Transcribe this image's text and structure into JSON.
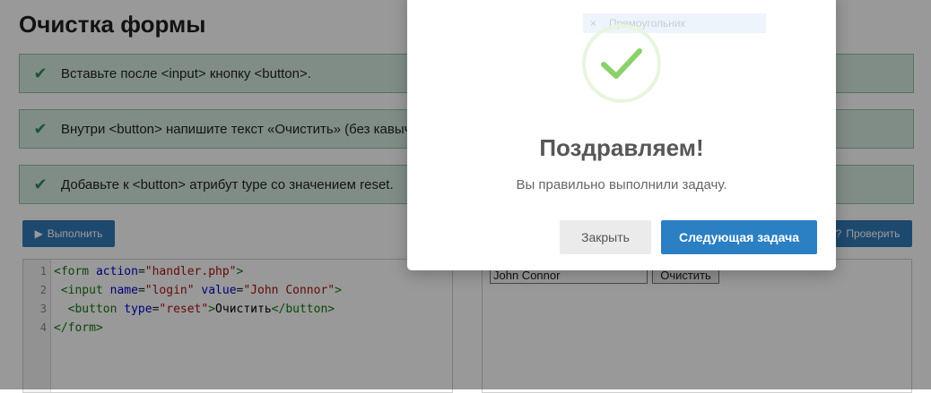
{
  "page": {
    "title": "Очистка формы"
  },
  "tasks": [
    {
      "text": "Вставьте после <input> кнопку <button>.",
      "done": true
    },
    {
      "text": "Внутри <button> напишите текст «Очистить» (без кавычек).",
      "done": true
    },
    {
      "text": "Добавьте к <button> атрибут type со значением reset.",
      "done": true
    }
  ],
  "toolbar": {
    "run_label": "Выполнить",
    "check_label": "Проверить"
  },
  "editor": {
    "lines": [
      {
        "n": "1",
        "indent": "",
        "tag_open": "<form",
        "a1": "action",
        "v1": "\"handler.php\"",
        "a2": "",
        "v2": "",
        "close": ">",
        "inner": "",
        "end": ""
      },
      {
        "n": "2",
        "indent": " ",
        "tag_open": "<input",
        "a1": "name",
        "v1": "\"login\"",
        "a2": "value",
        "v2": "\"John Connor\"",
        "close": ">",
        "inner": "",
        "end": ""
      },
      {
        "n": "3",
        "indent": "  ",
        "tag_open": "<button",
        "a1": "type",
        "v1": "\"reset\"",
        "a2": "",
        "v2": "",
        "close": ">",
        "inner": "Очистить",
        "end": "</button>"
      },
      {
        "n": "4",
        "indent": "",
        "tag_open": "</form>",
        "a1": "",
        "v1": "",
        "a2": "",
        "v2": "",
        "close": "",
        "inner": "",
        "end": ""
      }
    ]
  },
  "preview": {
    "input_value": "John Connor",
    "button_label": "Очистить"
  },
  "modal": {
    "ghost_text": "Прямоугольник",
    "title": "Поздравляем!",
    "message": "Вы правильно выполнили задачу.",
    "close_label": "Закрыть",
    "next_label": "Следующая задача",
    "colors": {
      "accent": "#2b7fc3",
      "success": "#8bd16b"
    }
  }
}
